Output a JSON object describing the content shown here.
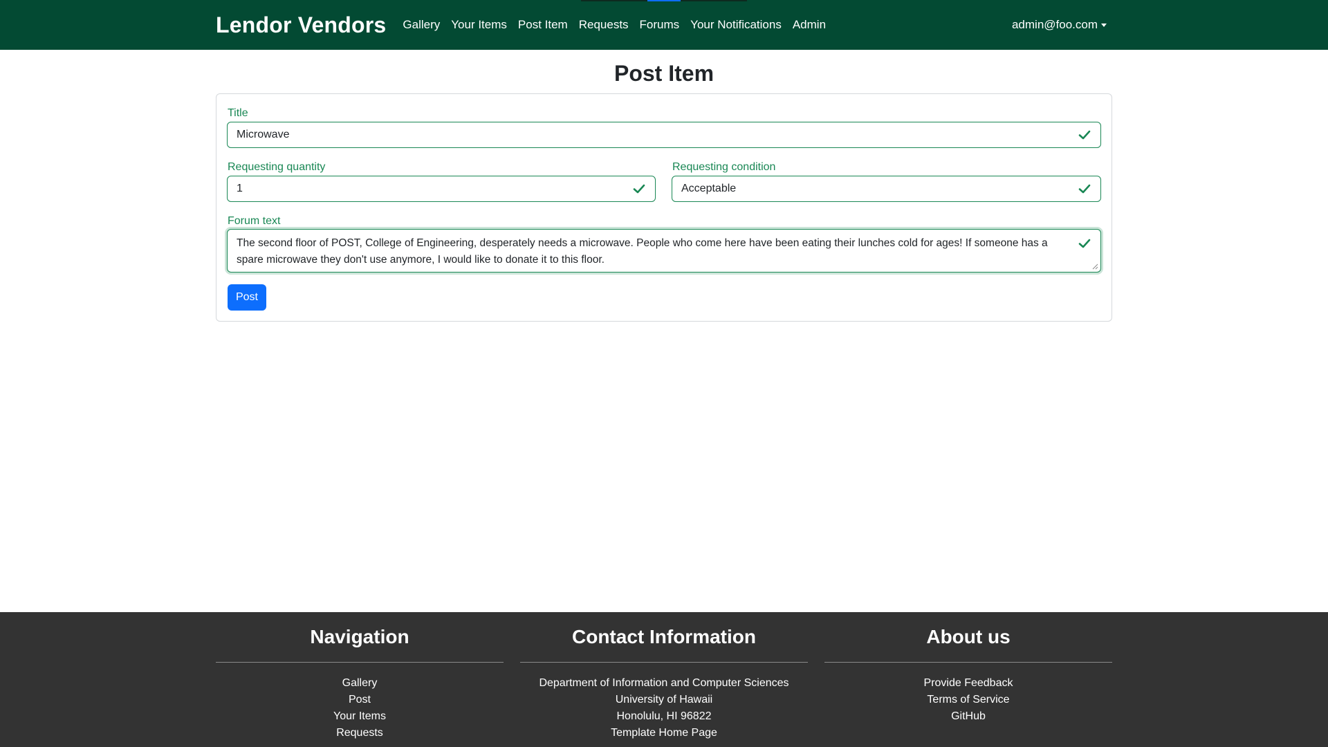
{
  "navbar": {
    "brand": "Lendor Vendors",
    "links": [
      "Gallery",
      "Your Items",
      "Post Item",
      "Requests",
      "Forums",
      "Your Notifications",
      "Admin"
    ],
    "user": "admin@foo.com",
    "colors": {
      "background": "#034a33",
      "text": "#ffffff"
    }
  },
  "page": {
    "title": "Post Item"
  },
  "form": {
    "title_label": "Title",
    "title_value": "Microwave",
    "quantity_label": "Requesting quantity",
    "quantity_value": "1",
    "condition_label": "Requesting condition",
    "condition_value": "Acceptable",
    "forum_label": "Forum text",
    "forum_value": "The second floor of POST, College of Engineering, desperately needs a microwave. People who come here have been eating their lunches cold for ages! If someone has a spare microwave they don't use anymore, I would like to donate it to this floor.",
    "submit_label": "Post",
    "valid_icon": "checkmark-icon",
    "colors": {
      "valid": "#198754",
      "primary_button": "#0d6efd"
    }
  },
  "footer": {
    "navigation": {
      "heading": "Navigation",
      "links": [
        "Gallery",
        "Post",
        "Your Items",
        "Requests"
      ]
    },
    "contact": {
      "heading": "Contact Information",
      "lines": [
        "Department of Information and Computer Sciences",
        "University of Hawaii",
        "Honolulu, HI 96822",
        "Template Home Page"
      ]
    },
    "about": {
      "heading": "About us",
      "links": [
        "Provide Feedback",
        "Terms of Service",
        "GitHub"
      ]
    },
    "colors": {
      "background": "#333333"
    }
  }
}
